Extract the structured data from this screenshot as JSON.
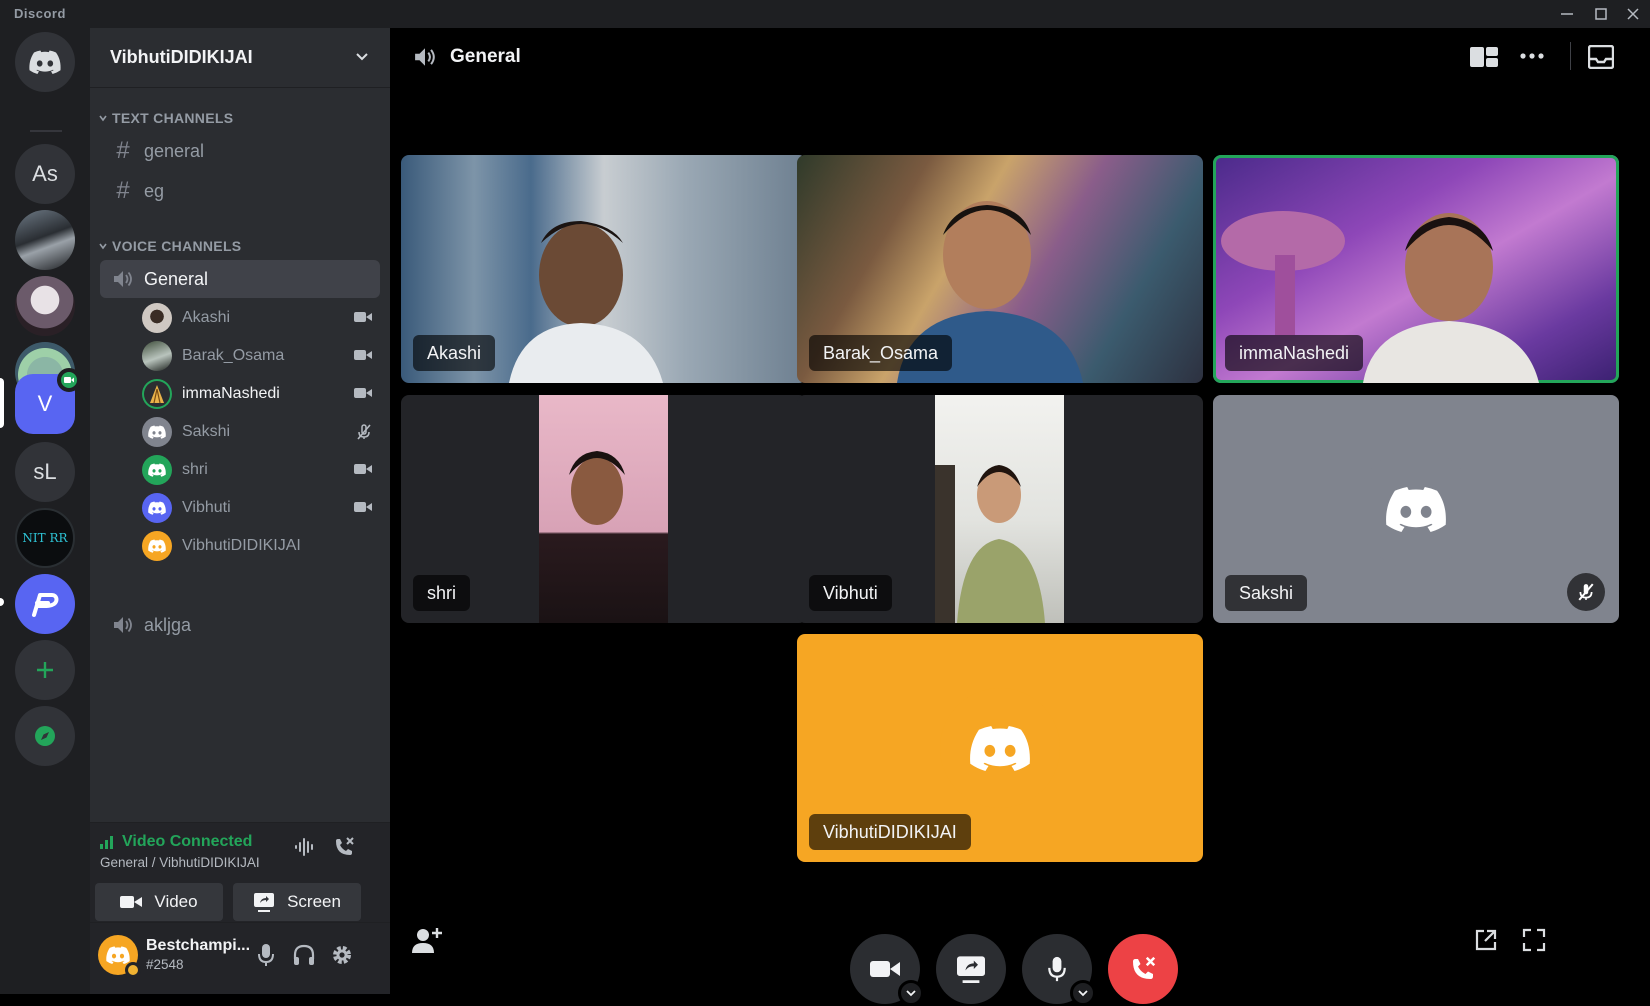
{
  "window": {
    "title": "Discord"
  },
  "servers": [
    {
      "label": ""
    },
    {
      "label": "As"
    },
    {
      "label": "sL"
    },
    {
      "label": "V"
    },
    {
      "label": "NIT RR"
    }
  ],
  "server": {
    "name": "VibhutiDIDIKIJAI"
  },
  "categories": {
    "text": "TEXT CHANNELS",
    "voice": "VOICE CHANNELS"
  },
  "text_channels": [
    "general",
    "eg"
  ],
  "voice_channels": [
    {
      "name": "General",
      "users": [
        "Akashi",
        "Barak_Osama",
        "immaNashedi",
        "Sakshi",
        "shri",
        "Vibhuti",
        "VibhutiDIDIKIJAI"
      ]
    },
    {
      "name": "akljga",
      "users": []
    }
  ],
  "voice_status": {
    "state": "Video Connected",
    "location": "General / VibhutiDIDIKIJAI"
  },
  "voice_buttons": {
    "video": "Video",
    "screen": "Screen"
  },
  "user": {
    "name": "Bestchampi...",
    "tag": "#2548"
  },
  "call": {
    "channel": "General"
  },
  "tiles": [
    {
      "name": "Akashi",
      "camera": true,
      "speaking": false
    },
    {
      "name": "Barak_Osama",
      "camera": true,
      "speaking": false
    },
    {
      "name": "immaNashedi",
      "camera": true,
      "speaking": true
    },
    {
      "name": "shri",
      "camera": true,
      "speaking": false
    },
    {
      "name": "Vibhuti",
      "camera": true,
      "speaking": false
    },
    {
      "name": "Sakshi",
      "camera": false,
      "muted": true,
      "speaking": false
    },
    {
      "name": "VibhutiDIDIKIJAI",
      "camera": false,
      "speaking": false
    }
  ],
  "colors": {
    "green": "#23a55a",
    "blurple": "#5865f2",
    "orange": "#f6a623",
    "red": "#ed4245",
    "grey_tile": "#80848e"
  }
}
